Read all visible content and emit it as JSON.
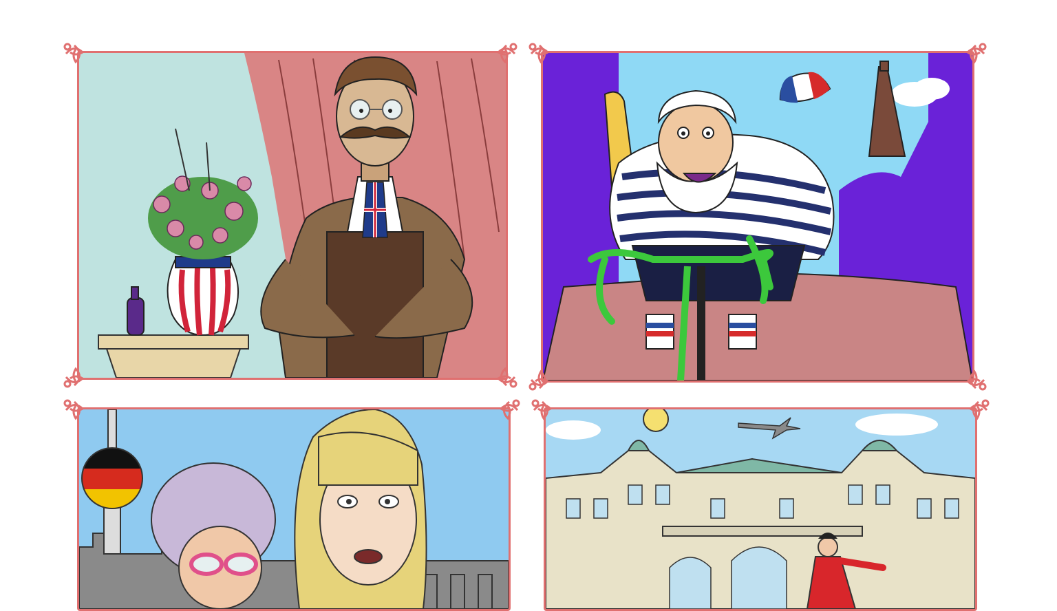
{
  "page": {
    "background": "#ffffff",
    "frame_color": "#e07070"
  },
  "panels": [
    {
      "id": "p1",
      "subject": "british-gentleman",
      "colors": {
        "wall": "#bfe3e0",
        "curtain": "#d98585",
        "jacket": "#7a5a3f",
        "tie_red": "#d1243a",
        "tie_blue": "#1f3b8a"
      }
    },
    {
      "id": "p2",
      "subject": "french-cyclist",
      "colors": {
        "sky": "#8fd9f5",
        "walls": "#6a22d8",
        "road": "#c98585",
        "stripe": "#24306e",
        "bike": "#3cc83c"
      }
    },
    {
      "id": "p3",
      "subject": "german-women",
      "colors": {
        "sky": "#8fcaf0",
        "skyline": "#8a8a8a",
        "flag_black": "#111111",
        "flag_red": "#d62b1e",
        "flag_gold": "#f2c300"
      }
    },
    {
      "id": "p4",
      "subject": "building-facade",
      "colors": {
        "sky": "#a7d8f3",
        "facade": "#e8e2c8",
        "roof": "#7fb8a6",
        "dress": "#d8262b"
      }
    }
  ]
}
